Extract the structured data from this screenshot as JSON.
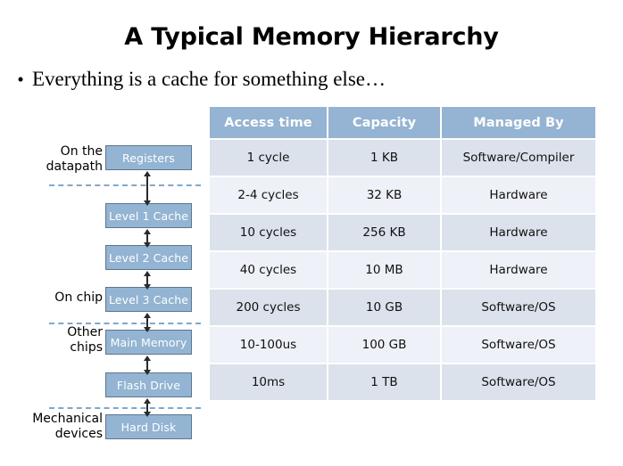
{
  "slide": {
    "title": "A Typical Memory Hierarchy",
    "bullet_marker": "•",
    "bullet_text": "Everything is a cache for something else…"
  },
  "colors": {
    "box_fill": "#93b4d2",
    "box_border": "#5d768f",
    "header_fill": "#95b3d2",
    "row_dark": "#dbe2ec",
    "row_light": "#eef1f7",
    "dash_line": "#7fa8cc",
    "text": "#000000",
    "box_text": "#ffffff"
  },
  "hierarchy": {
    "boxes": [
      {
        "label": "Registers"
      },
      {
        "label": "Level 1 Cache"
      },
      {
        "label": "Level 2 Cache"
      },
      {
        "label": "Level 3 Cache"
      },
      {
        "label": "Main Memory"
      },
      {
        "label": "Flash Drive"
      },
      {
        "label": "Hard Disk"
      }
    ],
    "labels": [
      {
        "line1": "On the",
        "line2": "datapath"
      },
      {
        "line1": "On chip",
        "line2": ""
      },
      {
        "line1": "Other",
        "line2": "chips"
      },
      {
        "line1": "Mechanical",
        "line2": "devices"
      }
    ]
  },
  "table": {
    "headers": [
      "Access time",
      "Capacity",
      "Managed By"
    ],
    "rows": [
      {
        "access_time": "1 cycle",
        "capacity": "1 KB",
        "managed_by": "Software/Compiler"
      },
      {
        "access_time": "2-4 cycles",
        "capacity": "32 KB",
        "managed_by": "Hardware"
      },
      {
        "access_time": "10 cycles",
        "capacity": "256 KB",
        "managed_by": "Hardware"
      },
      {
        "access_time": "40 cycles",
        "capacity": "10 MB",
        "managed_by": "Hardware"
      },
      {
        "access_time": "200 cycles",
        "capacity": "10 GB",
        "managed_by": "Software/OS"
      },
      {
        "access_time": "10-100us",
        "capacity": "100 GB",
        "managed_by": "Software/OS"
      },
      {
        "access_time": "10ms",
        "capacity": "1 TB",
        "managed_by": "Software/OS"
      }
    ]
  }
}
